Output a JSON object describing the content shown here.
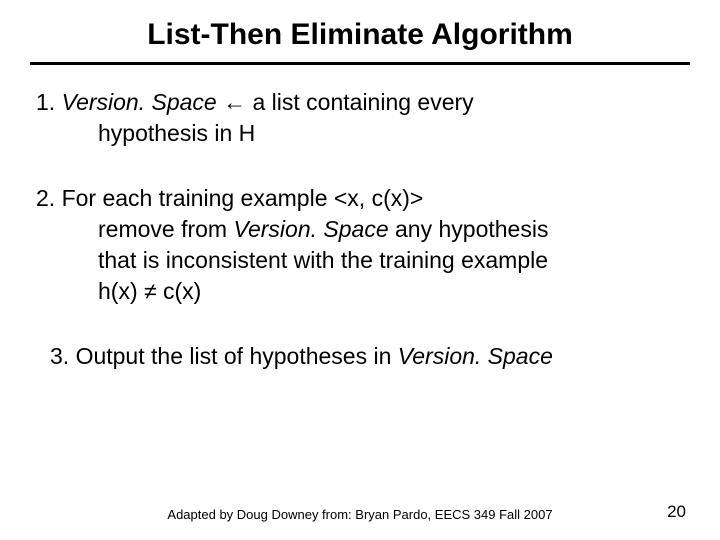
{
  "title": "List-Then Eliminate Algorithm",
  "step1": {
    "num": "1. ",
    "vs": "Version. Space",
    "arrow": " ← ",
    "rest": "a list containing every",
    "line2": "hypothesis in H"
  },
  "step2": {
    "line1": "2. For each training example <x, c(x)>",
    "line2a": "remove from ",
    "vs": "Version. Space",
    "line2b": " any hypothesis",
    "line3": "that is inconsistent with the training example",
    "line4": "h(x) ≠ c(x)"
  },
  "step3": {
    "text": "3. Output the list of hypotheses in ",
    "vs": "Version. Space"
  },
  "footer": "Adapted by Doug Downey from: Bryan Pardo, EECS 349 Fall 2007",
  "page": "20"
}
